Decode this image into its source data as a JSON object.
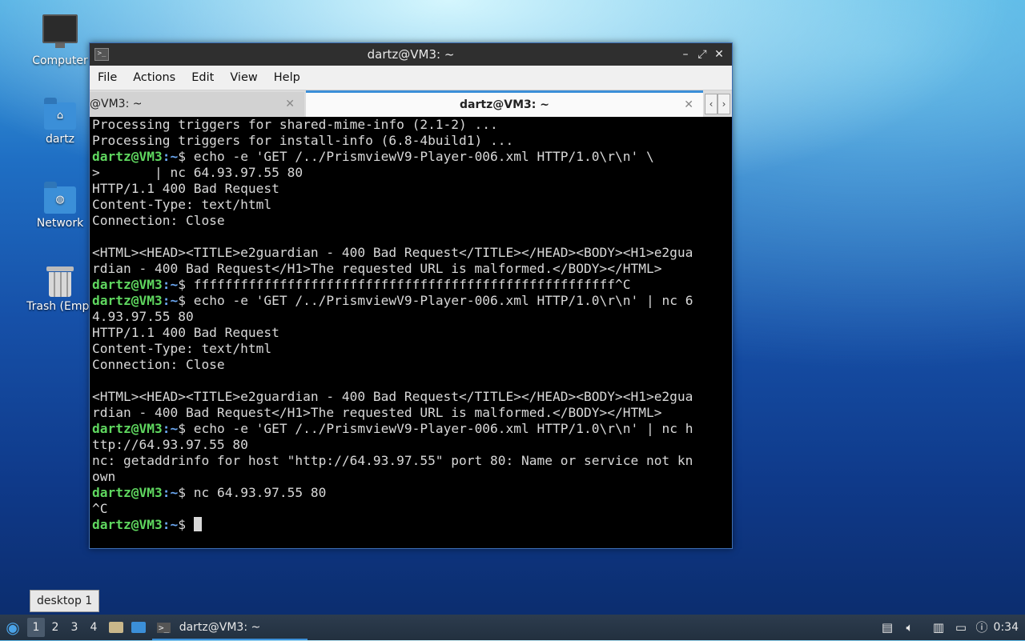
{
  "desktop": {
    "icons": [
      {
        "label": "Computer"
      },
      {
        "label": "dartz"
      },
      {
        "label": "Network"
      },
      {
        "label": "Trash (Empt"
      }
    ],
    "tooltip": "desktop 1"
  },
  "window": {
    "title": "dartz@VM3: ~",
    "app_icon_glyph": ">_",
    "buttons": {
      "minimize": "–",
      "maximize": "⤢",
      "close": "✕"
    },
    "menu": [
      "File",
      "Actions",
      "Edit",
      "View",
      "Help"
    ],
    "tabs": [
      {
        "label": "@VM3: ~",
        "active": false,
        "close": "✕"
      },
      {
        "label": "dartz@VM3: ~",
        "active": true,
        "close": "✕"
      }
    ],
    "tab_nav": {
      "prev": "‹",
      "next": "›"
    }
  },
  "terminal": {
    "prompt_user": "dartz@VM3",
    "prompt_path": ":~",
    "prompt_symbol": "$ ",
    "lines": [
      {
        "text": "Processing triggers for shared-mime-info (2.1-2) ..."
      },
      {
        "text": "Processing triggers for install-info (6.8-4build1) ..."
      },
      {
        "cmd": "echo -e 'GET /../PrismviewV9-Player-006.xml HTTP/1.0\\r\\n' \\"
      },
      {
        "text": ">       | nc 64.93.97.55 80"
      },
      {
        "text": "HTTP/1.1 400 Bad Request"
      },
      {
        "text": "Content-Type: text/html"
      },
      {
        "text": "Connection: Close"
      },
      {
        "text": ""
      },
      {
        "text": "<HTML><HEAD><TITLE>e2guardian - 400 Bad Request</TITLE></HEAD><BODY><H1>e2gua"
      },
      {
        "text": "rdian - 400 Bad Request</H1>The requested URL is malformed.</BODY></HTML>"
      },
      {
        "cmd": "ffffffffffffffffffffffffffffffffffffffffffffffffffffff^C"
      },
      {
        "cmd": "echo -e 'GET /../PrismviewV9-Player-006.xml HTTP/1.0\\r\\n' | nc 6"
      },
      {
        "text": "4.93.97.55 80"
      },
      {
        "text": "HTTP/1.1 400 Bad Request"
      },
      {
        "text": "Content-Type: text/html"
      },
      {
        "text": "Connection: Close"
      },
      {
        "text": ""
      },
      {
        "text": "<HTML><HEAD><TITLE>e2guardian - 400 Bad Request</TITLE></HEAD><BODY><H1>e2gua"
      },
      {
        "text": "rdian - 400 Bad Request</H1>The requested URL is malformed.</BODY></HTML>"
      },
      {
        "cmd": "echo -e 'GET /../PrismviewV9-Player-006.xml HTTP/1.0\\r\\n' | nc h"
      },
      {
        "text": "ttp://64.93.97.55 80"
      },
      {
        "text": "nc: getaddrinfo for host \"http://64.93.97.55\" port 80: Name or service not kn"
      },
      {
        "text": "own"
      },
      {
        "cmd": "nc 64.93.97.55 80"
      },
      {
        "text": "^C"
      },
      {
        "cmd": "",
        "cursor": true
      }
    ]
  },
  "taskbar": {
    "start_glyph": "◉",
    "workspaces": [
      "1",
      "2",
      "3",
      "4"
    ],
    "current_workspace": "1",
    "task_label": "dartz@VM3: ~",
    "task_icon_glyph": ">_",
    "clock": "0:34",
    "colors": {
      "accent": "#3b8fd8",
      "panel": "#273545"
    }
  }
}
